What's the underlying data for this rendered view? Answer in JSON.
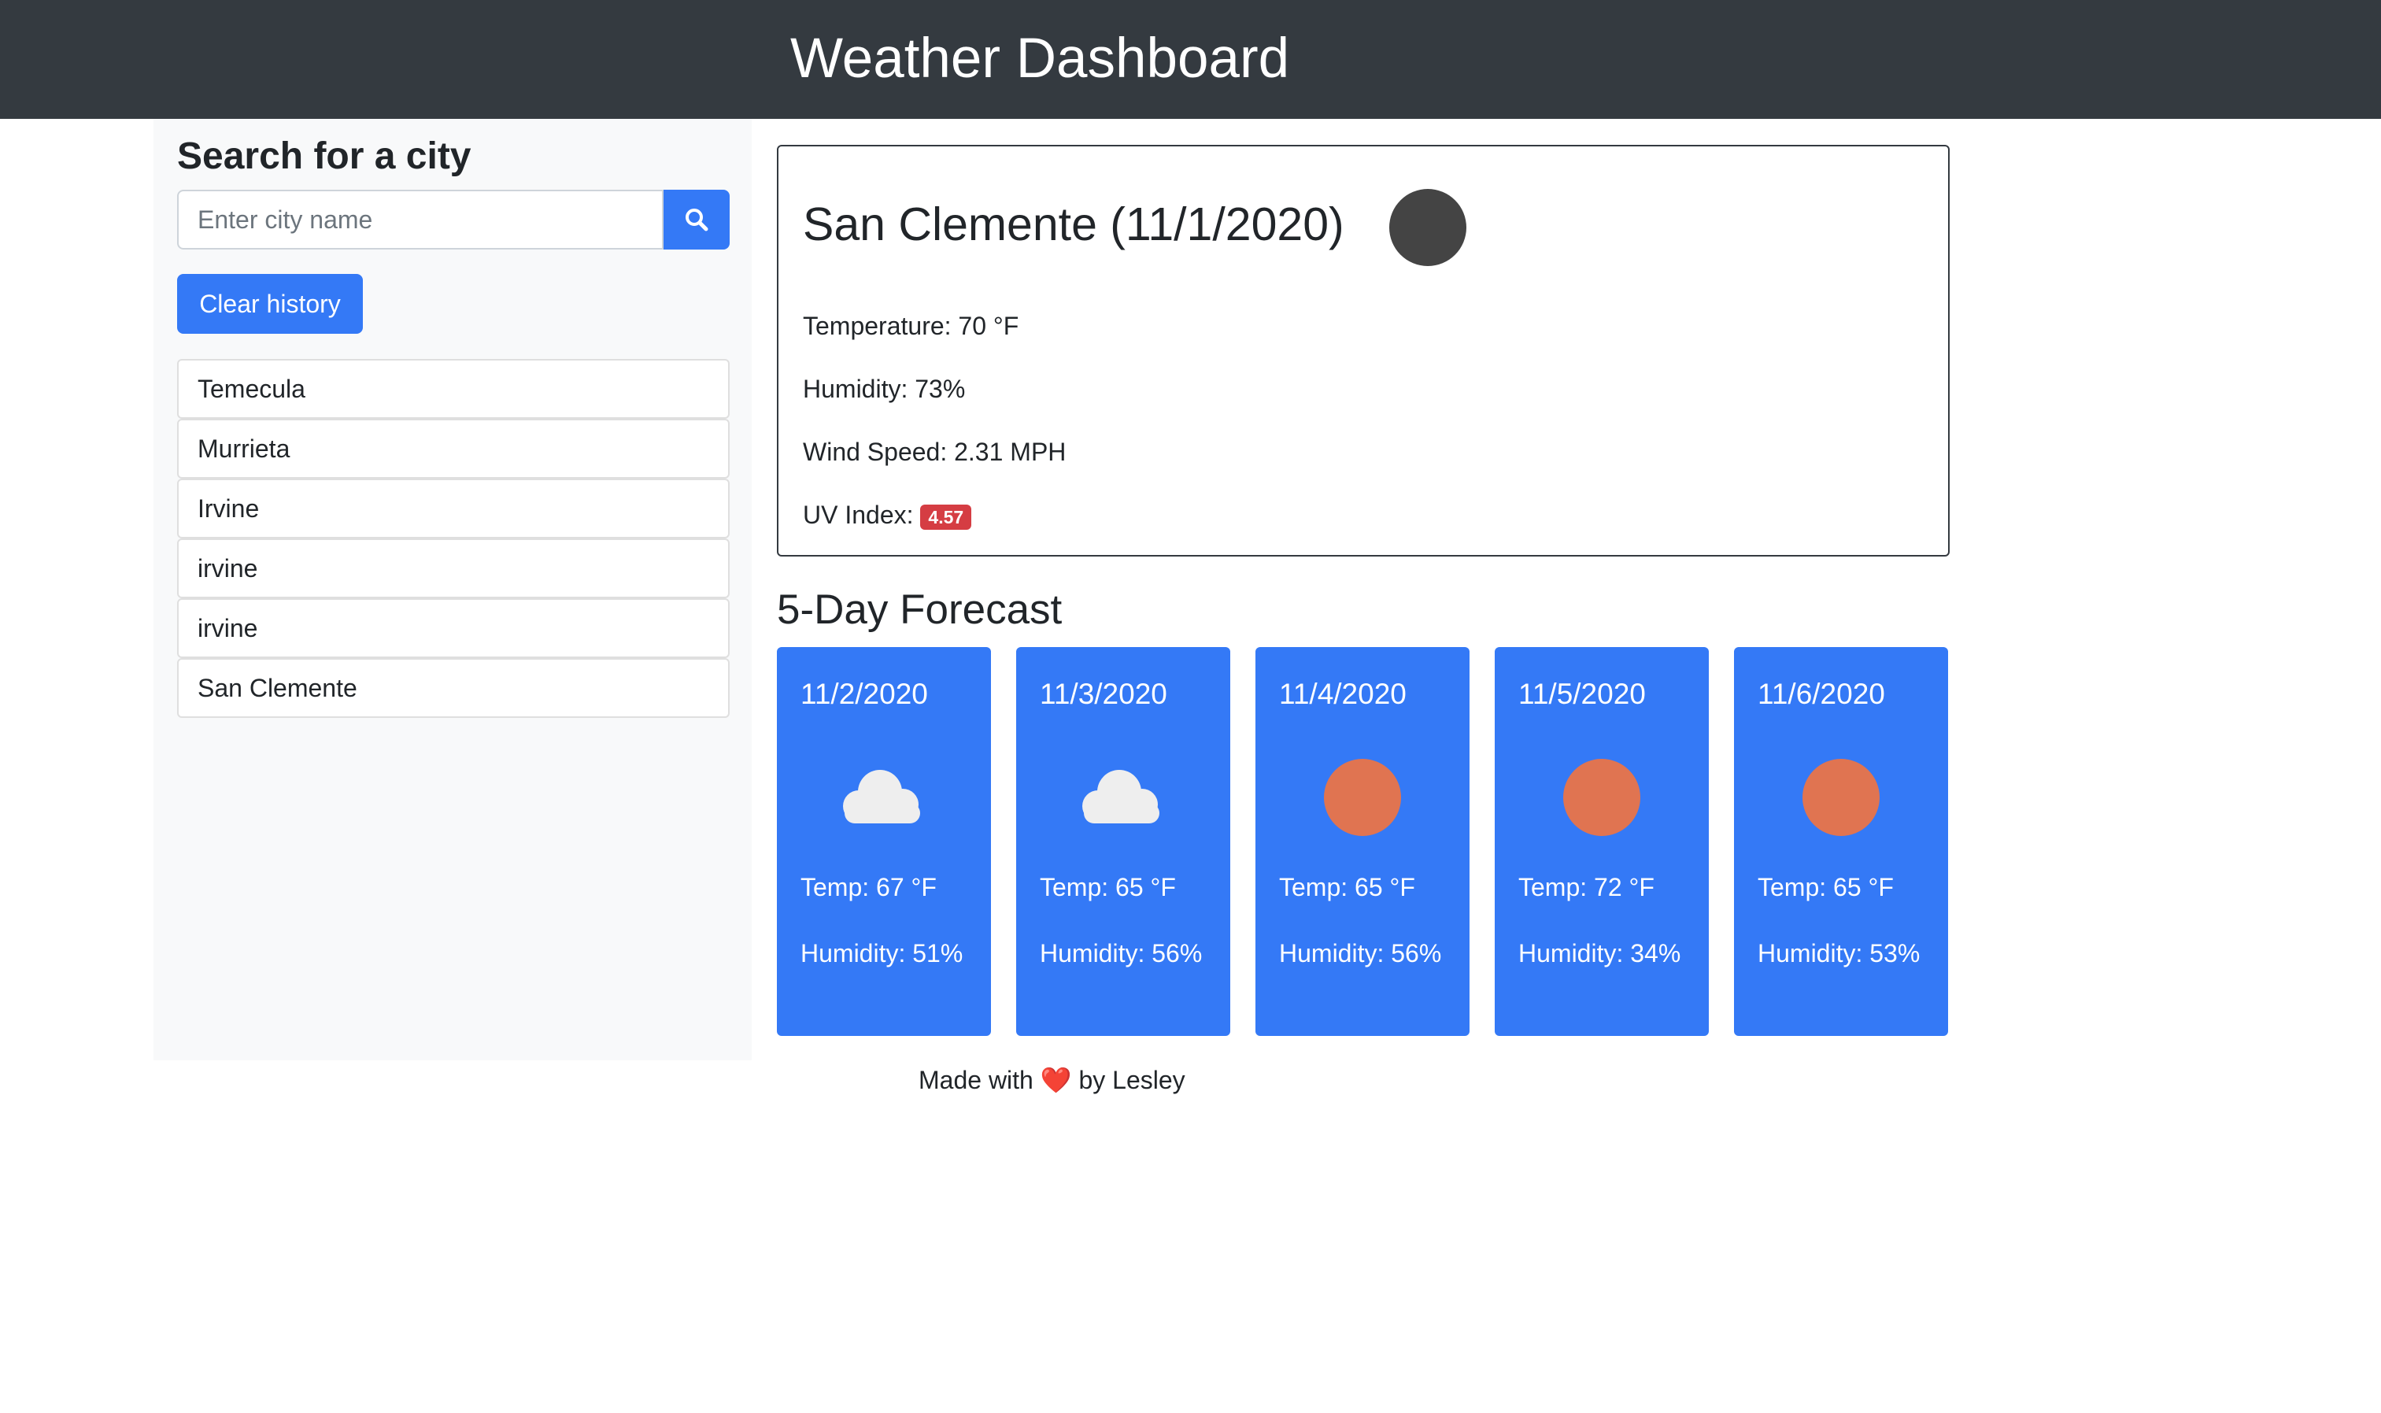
{
  "header": {
    "title": "Weather Dashboard"
  },
  "sidebar": {
    "title": "Search for a city",
    "search": {
      "placeholder": "Enter city name",
      "value": ""
    },
    "search_button_icon": "search-icon",
    "clear_label": "Clear history",
    "history": [
      {
        "label": "Temecula"
      },
      {
        "label": "Murrieta"
      },
      {
        "label": "Irvine"
      },
      {
        "label": "irvine"
      },
      {
        "label": "irvine"
      },
      {
        "label": "San Clemente"
      }
    ]
  },
  "current": {
    "title": "San Clemente (11/1/2020)",
    "icon": "moon-icon",
    "temperature": "Temperature: 70 °F",
    "humidity": "Humidity: 73%",
    "wind": "Wind Speed: 2.31 MPH",
    "uv_label": "UV Index:",
    "uv_value": "4.57",
    "uv_color": "#d53d43"
  },
  "forecast": {
    "heading": "5-Day Forecast",
    "days": [
      {
        "date": "11/2/2020",
        "icon": "cloud-icon",
        "temp": "Temp: 67 °F",
        "humidity": "Humidity: 51%"
      },
      {
        "date": "11/3/2020",
        "icon": "cloud-icon",
        "temp": "Temp: 65 °F",
        "humidity": "Humidity: 56%"
      },
      {
        "date": "11/4/2020",
        "icon": "sun-icon",
        "temp": "Temp: 65 °F",
        "humidity": "Humidity: 56%"
      },
      {
        "date": "11/5/2020",
        "icon": "sun-icon",
        "temp": "Temp: 72 °F",
        "humidity": "Humidity: 34%"
      },
      {
        "date": "11/6/2020",
        "icon": "sun-icon",
        "temp": "Temp: 65 °F",
        "humidity": "Humidity: 53%"
      }
    ]
  },
  "footer": {
    "prefix": "Made with",
    "heart": "❤️",
    "suffix": "by Lesley"
  },
  "colors": {
    "navbar": "#343a40",
    "accent": "#3479f6",
    "sidebar_bg": "#f8f9fa",
    "sun": "#e07451",
    "moon": "#444444"
  }
}
